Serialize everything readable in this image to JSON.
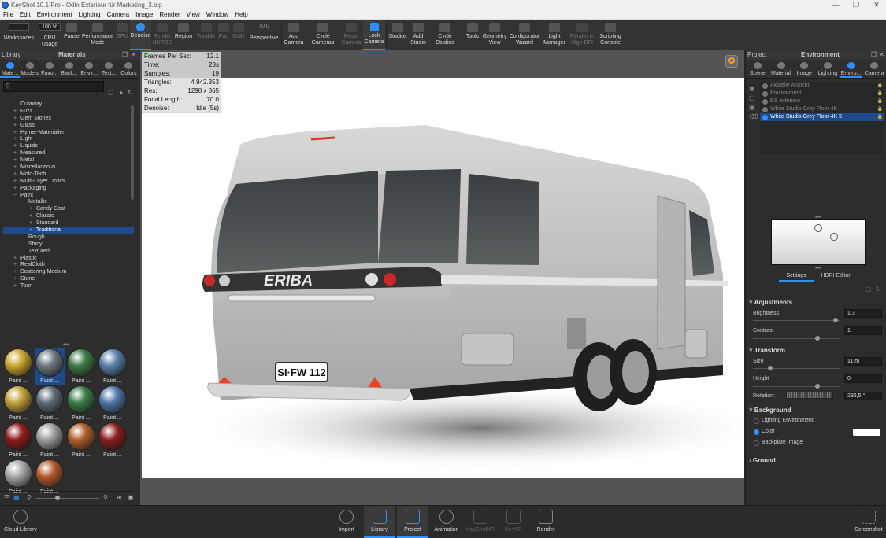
{
  "window": {
    "title": "KeyShot 10.1 Pro - Odin Exterieur für Marketing_3.bip"
  },
  "menu": [
    "File",
    "Edit",
    "Environment",
    "Lighting",
    "Camera",
    "Image",
    "Render",
    "View",
    "Window",
    "Help"
  ],
  "toolbar": {
    "zoom": "100 %",
    "tools": [
      {
        "label": "Workspaces"
      },
      {
        "label": "CPU Usage"
      },
      {
        "label": "Pause"
      },
      {
        "label": "Performance Mode"
      },
      {
        "label": "GPU"
      },
      {
        "label": "Denoise"
      },
      {
        "label": "Render NURBS"
      },
      {
        "label": "Region"
      },
      {
        "label": "Tumble"
      },
      {
        "label": "Pan"
      },
      {
        "label": "Dolly"
      },
      {
        "label": "Perspective"
      },
      {
        "label": "Add Camera"
      },
      {
        "label": "Cycle Cameras"
      },
      {
        "label": "Reset Camera"
      },
      {
        "label": "Lock Camera"
      },
      {
        "label": "Studios"
      },
      {
        "label": "Add Studio"
      },
      {
        "label": "Cycle Studios"
      },
      {
        "label": "Tools"
      },
      {
        "label": "Geometry View"
      },
      {
        "label": "Configurator Wizard"
      },
      {
        "label": "Light Manager"
      },
      {
        "label": "Render in High DPI"
      },
      {
        "label": "Scripting Console"
      }
    ],
    "fov_value": "70,0"
  },
  "library": {
    "header_left": "Library",
    "header_title": "Materials",
    "tabs": [
      "Mate...",
      "Models",
      "Favo...",
      "Back...",
      "Envir...",
      "Text...",
      "Colors"
    ],
    "tree": [
      "Cutaway",
      "Fuzz",
      "Gem Stones",
      "Glass",
      "Hymer-Materialien",
      "Light",
      "Liquids",
      "Measured",
      "Metal",
      "Miscellaneous",
      "Mold-Tech",
      "Multi-Layer Optics",
      "Packaging",
      "Paint",
      "Metallic",
      "Candy Coat",
      "Classic",
      "Standard",
      "Traditional",
      "Rough",
      "Shiny",
      "Textured",
      "Plastic",
      "RealCloth",
      "Scattering Medium",
      "Stone",
      "Toon"
    ],
    "swatch_label": "Paint ...",
    "swatches": [
      "#c9a62c",
      "#6c7880",
      "#3f7a45",
      "#5a7ea8",
      "#c2a03a",
      "#5e6b75",
      "#3c7c48",
      "#4f76a5",
      "#8e1c1c",
      "#9d9d9d",
      "#b0602f",
      "#8a1e1e",
      "#a8a8a8",
      "#b2582a"
    ]
  },
  "viewport": {
    "stats": [
      {
        "k": "Frames Per Sec:",
        "v": "12.1"
      },
      {
        "k": "Time:",
        "v": "28s"
      },
      {
        "k": "Samples:",
        "v": "19"
      },
      {
        "k": "Triangles:",
        "v": "4.942.353"
      },
      {
        "k": "Res:",
        "v": "1298 x 865"
      },
      {
        "k": "Focal Length:",
        "v": "70.0"
      },
      {
        "k": "Denoise:",
        "v": "Idle (5s)"
      }
    ],
    "logo": "ERIBA",
    "plate": "SI·FW 112"
  },
  "project": {
    "header_left": "Project",
    "header_title": "Environment",
    "tabs": [
      "Scene",
      "Material",
      "Image",
      "Lighting",
      "Enviro...",
      "Camera"
    ],
    "envs": [
      "Aktuelle Ansicht",
      "Environment",
      "BS exterieur",
      "White Studio Grey Floor 4K",
      "White Studio Grey Floor 4K 5"
    ],
    "subtabs": [
      "Settings",
      "HDRI Editor"
    ],
    "adjustments": "Adjustments",
    "brightness_label": "Brightness",
    "brightness": "1,3",
    "contrast_label": "Contrast",
    "contrast": "1",
    "transform": "Transform",
    "size_label": "Size",
    "size": "11 m",
    "height_label": "Height",
    "height": "0",
    "rotation_label": "Rotation:",
    "rotation": "296,5 °",
    "background": "Background",
    "bg_options": [
      "Lighting Environment",
      "Color",
      "Backplate Image"
    ],
    "bg_color": "#ffffff",
    "ground": "Ground"
  },
  "bottom": {
    "cloud": "Cloud Library",
    "buttons": [
      "Import",
      "Library",
      "Project",
      "Animation",
      "KeyShotXR",
      "KeyVR",
      "Render"
    ],
    "screenshot": "Screenshot"
  }
}
